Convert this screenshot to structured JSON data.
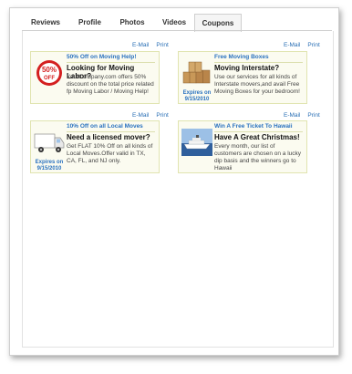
{
  "tabs": [
    {
      "label": "Reviews"
    },
    {
      "label": "Profile"
    },
    {
      "label": "Photos"
    },
    {
      "label": "Videos"
    },
    {
      "label": "Coupons",
      "active": true
    }
  ],
  "actions": {
    "email": "E-Mail",
    "print": "Print"
  },
  "coupons": [
    {
      "title": "50% Off on Moving Help!",
      "heading": "Looking for Moving Labor?",
      "body": "YourCompany.com offers 50% discount on the total price related fp Moving Labor / Moving Help!",
      "badge": "50% OFF",
      "icon": "discount-badge-icon"
    },
    {
      "title": "Free Moving Boxes",
      "heading": "Moving Interstate?",
      "body": "Use our services for all kinds of Interstate movers,and avail Free Moving Boxes for your bedroom!",
      "expires": "Expires on 9/15/2010",
      "icon": "boxes-icon"
    },
    {
      "title": "10% Off on all Local Moves",
      "heading": "Need a licensed mover?",
      "body": "Get FLAT 10% Off on all kinds of Local Moves.Offer valid in TX, CA, FL, and NJ only.",
      "expires": "Expires on 9/15/2010",
      "icon": "truck-icon"
    },
    {
      "title": "Win A Free Ticket To Hawaii",
      "heading": "Have A Great Christmas!",
      "body": "Every month, our list of customers are chosen on a lucky dip basis and the winners go to Hawaii",
      "icon": "cruise-ship-icon"
    }
  ],
  "colors": {
    "accent": "#2a72c0",
    "card_bg": "#fbfbf0",
    "card_border": "#e0e4b0",
    "badge_red": "#d42020"
  }
}
